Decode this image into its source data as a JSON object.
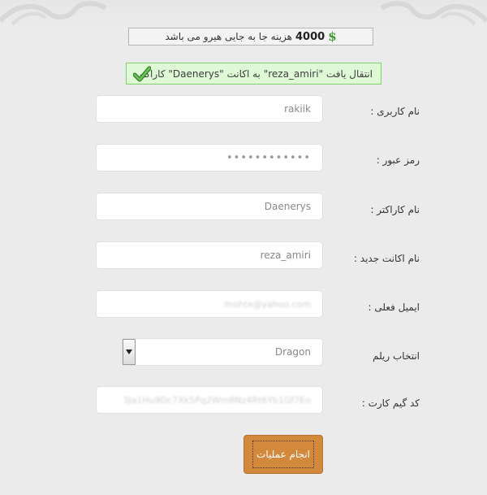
{
  "cost": {
    "amount": "4000",
    "text": "هزینه جا به جایی هیرو می باشد",
    "icon": "dollar-sign-icon",
    "icon_color": "#3c9a2e"
  },
  "success": {
    "message": "کاراکتر \"Daenerys\" به اکانت \"reza_amiri\" انتقال یافت",
    "icon": "checkmark-icon",
    "border_color": "#7fd36f",
    "background_color": "#dff8d6"
  },
  "form": {
    "username": {
      "label": "نام کاربری :",
      "value": "rakiik"
    },
    "password": {
      "label": "رمز عبور :",
      "value": "••••••••••••"
    },
    "character": {
      "label": "نام کاراکتر :",
      "value": "Daenerys"
    },
    "new_account": {
      "label": "نام اکانت جدید :",
      "value": "reza_amiri"
    },
    "email": {
      "label": "ایمیل فعلی :",
      "value": "mohtx@yahoo.com"
    },
    "realm": {
      "label": "انتخاب ریلم",
      "value": "Dragon"
    },
    "game_card": {
      "label": "کد گیم کارت :",
      "value": "3Ja1Hu9Dc7Xk5Pq2Wm8Nz4Rt6Yb1Gf7Eo"
    },
    "submit_label": "انجام عملیات"
  },
  "colors": {
    "page_background": "#ebebeb",
    "button": "#d3893c"
  }
}
